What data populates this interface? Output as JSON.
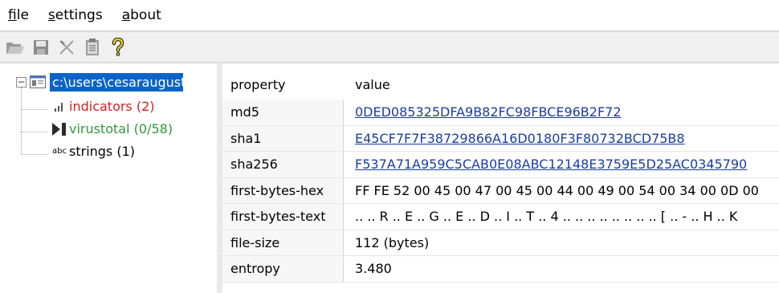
{
  "menubar": {
    "items": [
      {
        "label": "file",
        "accel": "f",
        "rest": "ile"
      },
      {
        "label": "settings",
        "accel": "s",
        "rest": "ettings"
      },
      {
        "label": "about",
        "accel": "a",
        "rest": "bout"
      }
    ]
  },
  "toolbar": {
    "buttons": [
      {
        "name": "open-folder-icon"
      },
      {
        "name": "save-icon"
      },
      {
        "name": "close-x-icon"
      },
      {
        "name": "clipboard-icon"
      },
      {
        "name": "help-question-icon"
      }
    ]
  },
  "tree": {
    "root_label": "c:\\users\\cesaraugust",
    "expander": "−",
    "children": [
      {
        "label": "indicators (2)",
        "icon": "bar-chart-icon",
        "color": "#d32020"
      },
      {
        "label": "virustotal (0/58)",
        "icon": "virustotal-arrow-icon",
        "color": "#2f9a36"
      },
      {
        "label": "strings (1)",
        "icon": "abc-icon",
        "color": "#000000"
      }
    ]
  },
  "grid": {
    "headers": {
      "property": "property",
      "value": "value"
    },
    "rows": [
      {
        "property": "md5",
        "value": "0DED085325DFA9B82FC98FBCE96B2F72",
        "link": true
      },
      {
        "property": "sha1",
        "value": "E45CF7F7F38729866A16D0180F3F80732BCD75B8",
        "link": true
      },
      {
        "property": "sha256",
        "value": "F537A71A959C5CAB0E08ABC12148E3759E5D25AC0345790",
        "link": true
      },
      {
        "property": "first-bytes-hex",
        "value": "FF FE 52 00 45 00 47 00 45 00 44 00 49 00 54 00 34 00 0D 00",
        "link": false
      },
      {
        "property": "first-bytes-text",
        "value": ".. .. R .. E .. G .. E .. D .. I .. T .. 4 .. .. .. .. .. .. .. .. [ .. - .. H .. K",
        "link": false
      },
      {
        "property": "file-size",
        "value": "112 (bytes)",
        "link": false
      },
      {
        "property": "entropy",
        "value": "3.480",
        "link": false
      }
    ]
  }
}
